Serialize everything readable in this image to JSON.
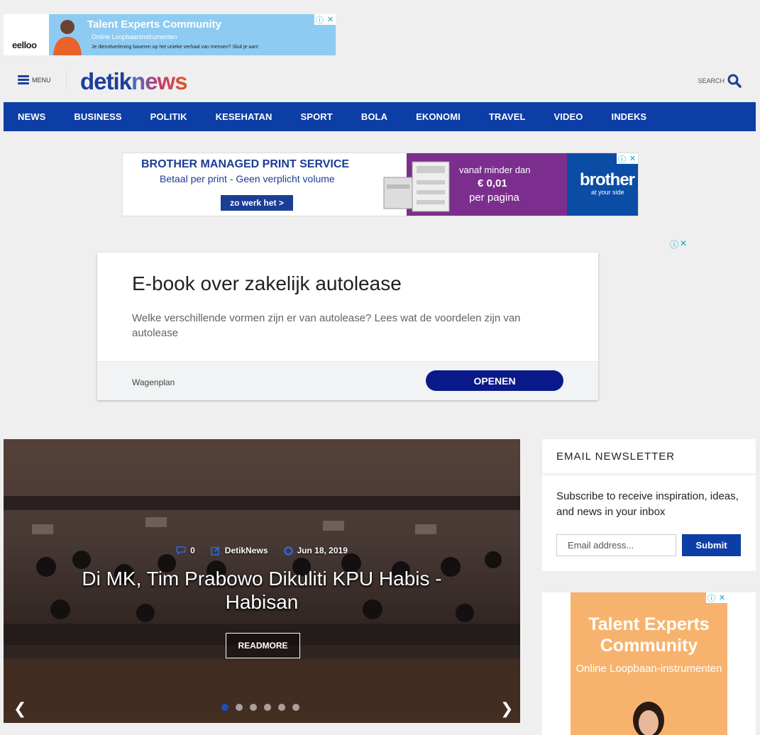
{
  "top_ad": {
    "logo": "eelloo",
    "headline": "Talent Experts Community",
    "subline": "Online Loopbaaninstrumenten",
    "tagline": "Je dienstverlening baseren op het unieke verhaal van mensen? Sluit je aan!",
    "info_icon": "ⓘ",
    "close_icon": "✕"
  },
  "header": {
    "menu_label": "MENU",
    "logo_part1": "detik",
    "logo_part2": "news",
    "search_label": "SEARCH"
  },
  "nav": {
    "items": [
      "NEWS",
      "BUSINESS",
      "POLITIK",
      "KESEHATAN",
      "SPORT",
      "BOLA",
      "EKONOMI",
      "TRAVEL",
      "VIDEO",
      "INDEKS"
    ]
  },
  "brother_ad": {
    "headline": "BROTHER MANAGED PRINT SERVICE",
    "subline": "Betaal per print - Geen verplicht volume",
    "cta": "zo werk het  >",
    "price_line1": "vanaf minder dan",
    "price_line2": "€ 0,01",
    "price_line3": "per pagina",
    "brand": "brother",
    "brand_tag": "at your side"
  },
  "native_ad": {
    "title": "E-book over zakelijk autolease",
    "description": "Welke verschillende vormen zijn er van autolease? Lees wat de voordelen zijn van autolease",
    "advertiser": "Wagenplan",
    "cta": "OPENEN"
  },
  "slider": {
    "comments": "0",
    "author": "DetikNews",
    "date": "Jun 18, 2019",
    "headline": "Di MK, Tim Prabowo Dikuliti KPU Habis - Habisan",
    "readmore": "READMORE",
    "prev_icon": "❮",
    "next_icon": "❯",
    "dot_count": 6,
    "active_dot": 0
  },
  "newsletter": {
    "title": "EMAIL NEWSLETTER",
    "description": "Subscribe to receive inspiration, ideas, and news in your inbox",
    "email_placeholder": "Email address...",
    "submit": "Submit"
  },
  "side_ad": {
    "headline": "Talent Experts Community",
    "subline": "Online Loopbaan-instrumenten"
  },
  "colors": {
    "brand_blue": "#0d3ea6",
    "background": "#efefef"
  }
}
